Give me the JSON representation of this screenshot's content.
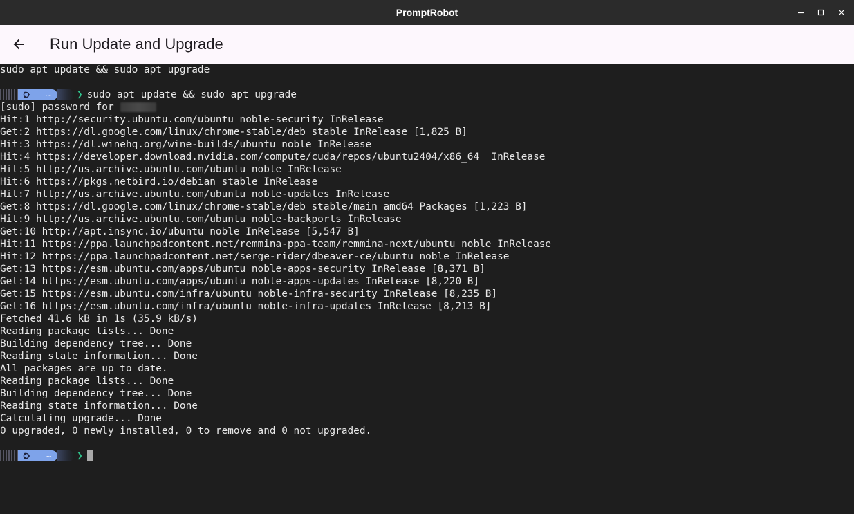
{
  "window": {
    "title": "PromptRobot",
    "controls": [
      "minimize-icon",
      "maximize-icon",
      "close-icon"
    ]
  },
  "appbar": {
    "title": "Run Update and Upgrade",
    "back_icon": "arrow-left-icon"
  },
  "terminal": {
    "command_echo": "sudo apt update && sudo apt upgrade",
    "prompt": {
      "tilde": "~",
      "chevron": "❯",
      "command": "sudo apt update && sudo apt upgrade"
    },
    "sudo_prompt": "[sudo] password for ",
    "output": [
      "Hit:1 http://security.ubuntu.com/ubuntu noble-security InRelease",
      "Get:2 https://dl.google.com/linux/chrome-stable/deb stable InRelease [1,825 B]",
      "Hit:3 https://dl.winehq.org/wine-builds/ubuntu noble InRelease",
      "Hit:4 https://developer.download.nvidia.com/compute/cuda/repos/ubuntu2404/x86_64  InRelease",
      "Hit:5 http://us.archive.ubuntu.com/ubuntu noble InRelease",
      "Hit:6 https://pkgs.netbird.io/debian stable InRelease",
      "Hit:7 http://us.archive.ubuntu.com/ubuntu noble-updates InRelease",
      "Get:8 https://dl.google.com/linux/chrome-stable/deb stable/main amd64 Packages [1,223 B]",
      "Hit:9 http://us.archive.ubuntu.com/ubuntu noble-backports InRelease",
      "Get:10 http://apt.insync.io/ubuntu noble InRelease [5,547 B]",
      "Hit:11 https://ppa.launchpadcontent.net/remmina-ppa-team/remmina-next/ubuntu noble InRelease",
      "Hit:12 https://ppa.launchpadcontent.net/serge-rider/dbeaver-ce/ubuntu noble InRelease",
      "Get:13 https://esm.ubuntu.com/apps/ubuntu noble-apps-security InRelease [8,371 B]",
      "Get:14 https://esm.ubuntu.com/apps/ubuntu noble-apps-updates InRelease [8,220 B]",
      "Get:15 https://esm.ubuntu.com/infra/ubuntu noble-infra-security InRelease [8,235 B]",
      "Get:16 https://esm.ubuntu.com/infra/ubuntu noble-infra-updates InRelease [8,213 B]",
      "Fetched 41.6 kB in 1s (35.9 kB/s)",
      "Reading package lists... Done",
      "Building dependency tree... Done",
      "Reading state information... Done",
      "All packages are up to date.",
      "Reading package lists... Done",
      "Building dependency tree... Done",
      "Reading state information... Done",
      "Calculating upgrade... Done",
      "0 upgraded, 0 newly installed, 0 to remove and 0 not upgraded."
    ],
    "colors": {
      "background": "#1e1e1e",
      "text": "#e8e8e8",
      "prompt_pill": "#7ea3ea",
      "chevron": "#2fc28c"
    }
  }
}
